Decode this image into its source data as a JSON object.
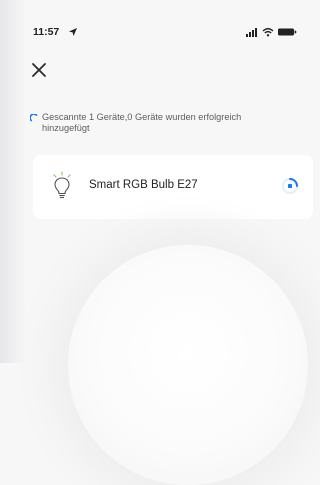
{
  "status_bar": {
    "time": "11:57",
    "location_icon": "location-arrow-icon",
    "signal_icon": "cellular-signal-icon",
    "wifi_icon": "wifi-icon",
    "battery_icon": "battery-icon"
  },
  "header": {
    "close_icon": "close-icon"
  },
  "scan": {
    "message": "Gescannte 1 Geräte,0 Geräte wurden erfolgreich hinzugefügt",
    "spinner_icon": "loading-spinner-icon",
    "accent_color": "#1677ff"
  },
  "devices": [
    {
      "name": "Smart RGB Bulb E27",
      "icon": "lightbulb-icon",
      "status_icon": "progress-indicator-icon"
    }
  ]
}
